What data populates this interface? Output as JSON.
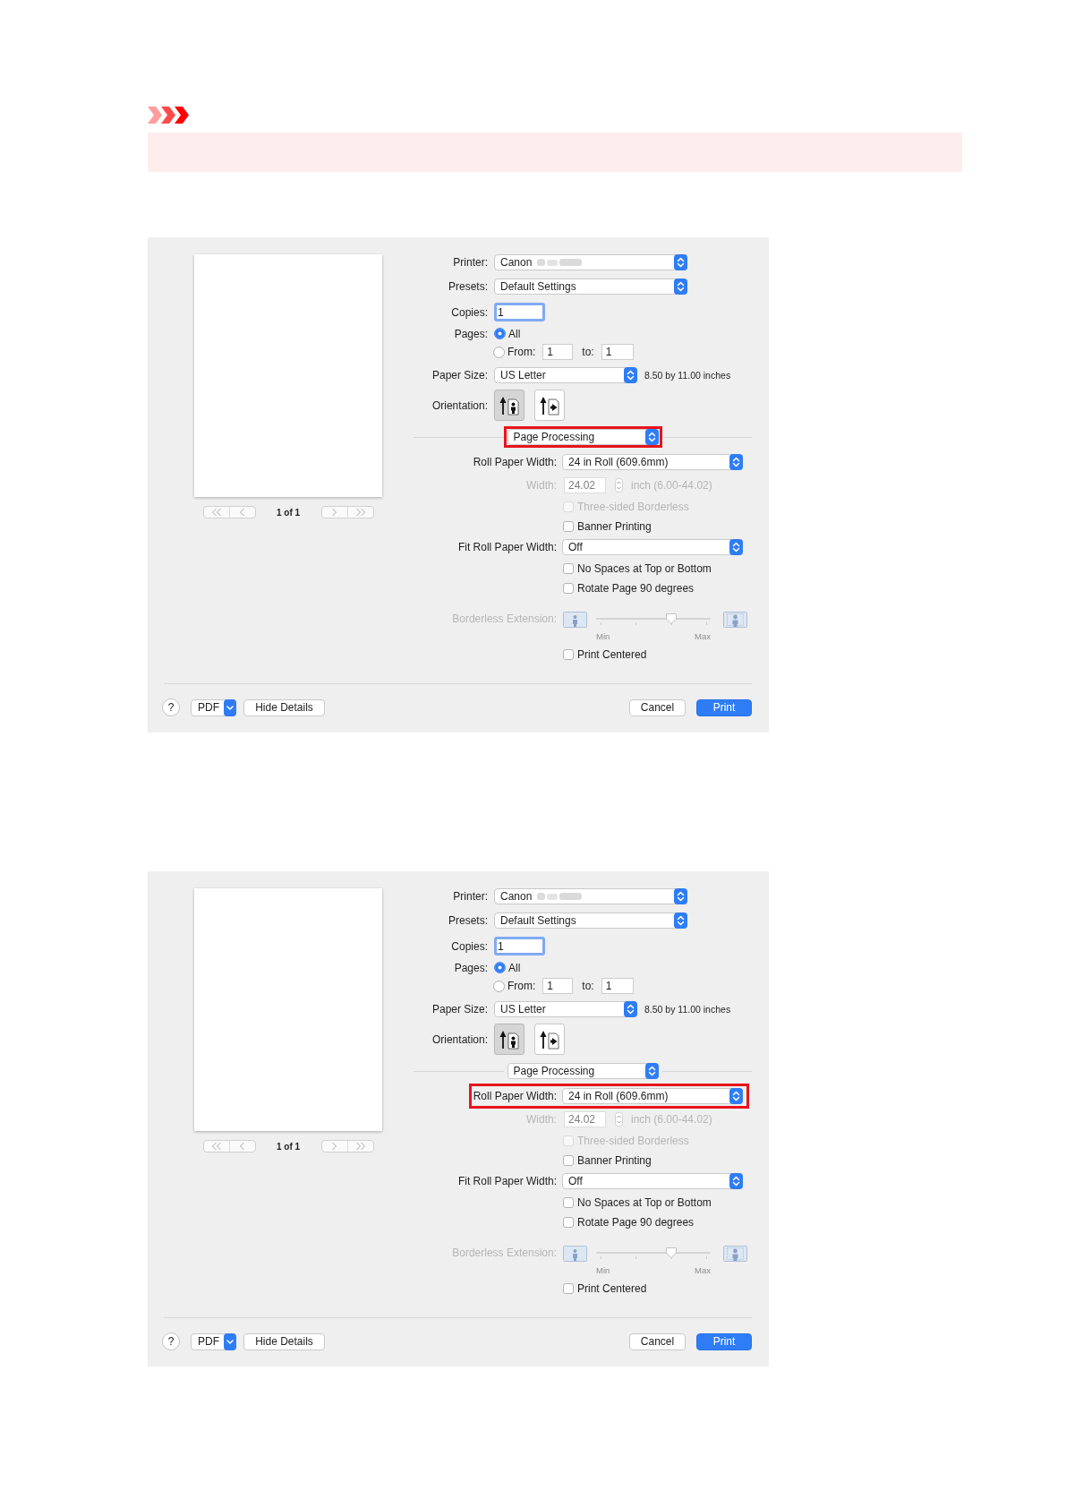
{
  "dialogs": [
    {
      "preview": {
        "page_count": "1 of 1"
      },
      "printer": {
        "label": "Printer:",
        "value": "Canon",
        "model_blurred": true
      },
      "presets": {
        "label": "Presets:",
        "value": "Default Settings"
      },
      "copies": {
        "label": "Copies:",
        "value": "1",
        "focused": true
      },
      "pages": {
        "label": "Pages:",
        "options": [
          {
            "label": "All",
            "selected": true
          },
          {
            "label": "From:",
            "selected": false
          }
        ],
        "from": "1",
        "to_label": "to:",
        "to": "1"
      },
      "paper_size": {
        "label": "Paper Size:",
        "value": "US Letter",
        "dimensions": "8.50 by 11.00 inches"
      },
      "orientation": {
        "label": "Orientation:",
        "options": [
          {
            "kind": "portrait",
            "selected": true
          },
          {
            "kind": "landscape",
            "selected": false
          }
        ]
      },
      "section": {
        "value": "Page Processing",
        "highlighted": true
      },
      "settings": [
        {
          "kind": "popup",
          "label": "Roll Paper Width:",
          "value": "24 in Roll (609.6mm)",
          "highlighted": false
        },
        {
          "kind": "number",
          "label": "Width:",
          "value": "24.02",
          "unit": "inch (6.00-44.02)",
          "disabled": true
        },
        {
          "kind": "checkbox",
          "label": "Three-sided Borderless",
          "checked": false,
          "disabled": true
        },
        {
          "kind": "checkbox",
          "label": "Banner Printing",
          "checked": false,
          "disabled": false
        },
        {
          "kind": "popup",
          "label": "Fit Roll Paper Width:",
          "value": "Off",
          "highlighted": false
        },
        {
          "kind": "checkbox",
          "label": "No Spaces at Top or Bottom",
          "checked": false,
          "disabled": false
        },
        {
          "kind": "checkbox",
          "label": "Rotate Page 90 degrees",
          "checked": false,
          "disabled": false
        },
        {
          "kind": "slider",
          "label": "Borderless Extension:",
          "level": 0.67,
          "min_label": "Min",
          "max_label": "Max",
          "disabled": true
        },
        {
          "kind": "checkbox",
          "label": "Print Centered",
          "checked": false,
          "disabled": false
        }
      ],
      "footer": {
        "help": "?",
        "pdf": "PDF",
        "hide_details": "Hide Details",
        "cancel": {
          "label": "Cancel",
          "default": false
        },
        "print": {
          "label": "Print",
          "default": true
        }
      }
    },
    {
      "preview": {
        "page_count": "1 of 1"
      },
      "printer": {
        "label": "Printer:",
        "value": "Canon",
        "model_blurred": true
      },
      "presets": {
        "label": "Presets:",
        "value": "Default Settings"
      },
      "copies": {
        "label": "Copies:",
        "value": "1",
        "focused": true
      },
      "pages": {
        "label": "Pages:",
        "options": [
          {
            "label": "All",
            "selected": true
          },
          {
            "label": "From:",
            "selected": false
          }
        ],
        "from": "1",
        "to_label": "to:",
        "to": "1"
      },
      "paper_size": {
        "label": "Paper Size:",
        "value": "US Letter",
        "dimensions": "8.50 by 11.00 inches"
      },
      "orientation": {
        "label": "Orientation:",
        "options": [
          {
            "kind": "portrait",
            "selected": true
          },
          {
            "kind": "landscape",
            "selected": false
          }
        ]
      },
      "section": {
        "value": "Page Processing",
        "highlighted": false
      },
      "settings": [
        {
          "kind": "popup",
          "label": "Roll Paper Width:",
          "value": "24 in Roll (609.6mm)",
          "highlighted": true
        },
        {
          "kind": "number",
          "label": "Width:",
          "value": "24.02",
          "unit": "inch (6.00-44.02)",
          "disabled": true
        },
        {
          "kind": "checkbox",
          "label": "Three-sided Borderless",
          "checked": false,
          "disabled": true
        },
        {
          "kind": "checkbox",
          "label": "Banner Printing",
          "checked": false,
          "disabled": false
        },
        {
          "kind": "popup",
          "label": "Fit Roll Paper Width:",
          "value": "Off",
          "highlighted": false
        },
        {
          "kind": "checkbox",
          "label": "No Spaces at Top or Bottom",
          "checked": false,
          "disabled": false
        },
        {
          "kind": "checkbox",
          "label": "Rotate Page 90 degrees",
          "checked": false,
          "disabled": false
        },
        {
          "kind": "slider",
          "label": "Borderless Extension:",
          "level": 0.67,
          "min_label": "Min",
          "max_label": "Max",
          "disabled": true
        },
        {
          "kind": "checkbox",
          "label": "Print Centered",
          "checked": false,
          "disabled": false
        }
      ],
      "footer": {
        "help": "?",
        "pdf": "PDF",
        "hide_details": "Hide Details",
        "cancel": {
          "label": "Cancel",
          "default": false
        },
        "print": {
          "label": "Print",
          "default": true
        }
      }
    }
  ]
}
